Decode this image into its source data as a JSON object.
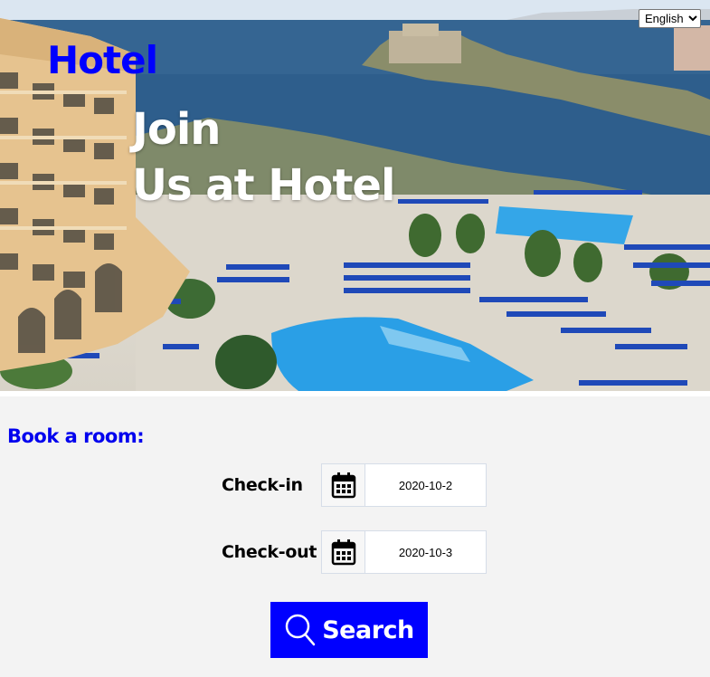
{
  "language": {
    "selected": "English"
  },
  "brand": {
    "name": "Hotel"
  },
  "hero": {
    "line1": "Join",
    "line2": "Us at Hotel"
  },
  "booking": {
    "title": "Book a room:",
    "checkin": {
      "label": "Check-in",
      "value": "2020-10-2"
    },
    "checkout": {
      "label": "Check-out",
      "value": "2020-10-3"
    },
    "search_label": "Search"
  },
  "icons": {
    "calendar": "calendar-icon",
    "search": "search-icon"
  },
  "colors": {
    "accent": "#0000ff",
    "title": "#0000ee",
    "background": "#f3f3f3"
  }
}
